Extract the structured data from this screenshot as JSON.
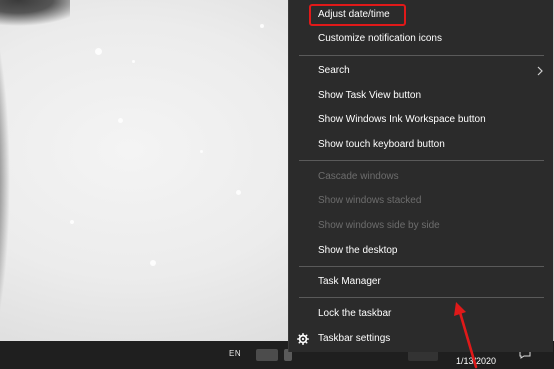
{
  "context_menu": {
    "items": [
      {
        "label": "Adjust date/time",
        "enabled": true
      },
      {
        "label": "Customize notification icons",
        "enabled": true
      },
      {
        "label": "Search",
        "enabled": true,
        "submenu": true
      },
      {
        "label": "Show Task View button",
        "enabled": true
      },
      {
        "label": "Show Windows Ink Workspace button",
        "enabled": true
      },
      {
        "label": "Show touch keyboard button",
        "enabled": true
      },
      {
        "label": "Cascade windows",
        "enabled": false
      },
      {
        "label": "Show windows stacked",
        "enabled": false
      },
      {
        "label": "Show windows side by side",
        "enabled": false
      },
      {
        "label": "Show the desktop",
        "enabled": true
      },
      {
        "label": "Task Manager",
        "enabled": true
      },
      {
        "label": "Lock the taskbar",
        "enabled": true
      },
      {
        "label": "Taskbar settings",
        "enabled": true,
        "icon": "gear-icon"
      }
    ]
  },
  "taskbar": {
    "language": "EN",
    "date": "1/13/2020"
  },
  "annotations": {
    "highlight_color": "#e01919",
    "arrow_color": "#e01919"
  },
  "colors": {
    "menu_bg": "#2b2b2b",
    "menu_text": "#ffffff",
    "menu_disabled_text": "#6d6d6d",
    "taskbar_bg": "#1f1f1f"
  }
}
